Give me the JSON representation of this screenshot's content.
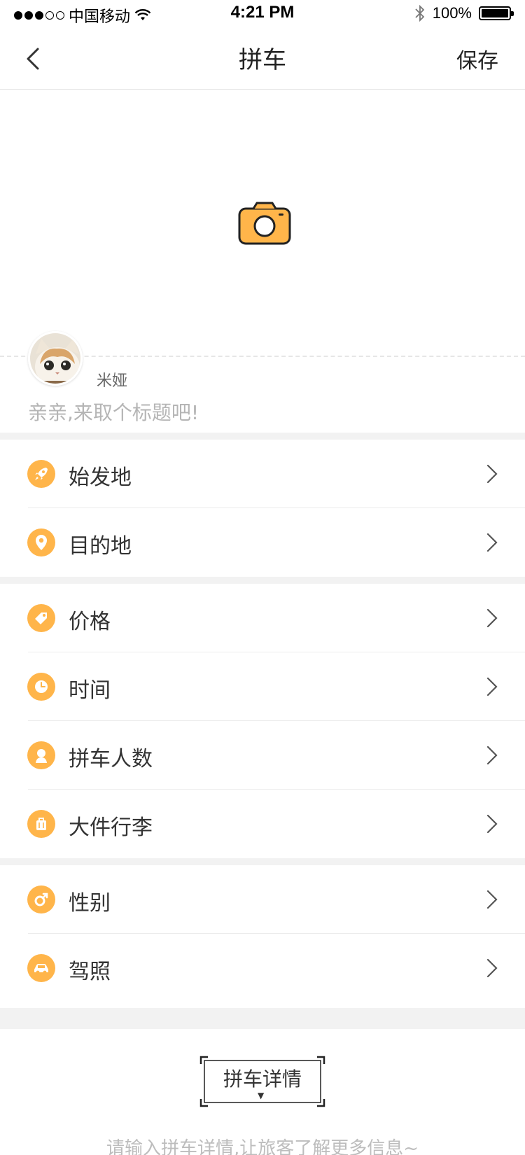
{
  "status_bar": {
    "carrier": "中国移动",
    "time": "4:21 PM",
    "battery": "100%"
  },
  "nav": {
    "title": "拼车",
    "save_label": "保存"
  },
  "post": {
    "username": "米娅",
    "title_placeholder": "亲亲,来取个标题吧!"
  },
  "groups": [
    {
      "items": [
        {
          "label": "始发地",
          "icon": "rocket-icon"
        },
        {
          "label": "目的地",
          "icon": "location-pin-icon"
        }
      ]
    },
    {
      "items": [
        {
          "label": "价格",
          "icon": "price-tag-icon"
        },
        {
          "label": "时间",
          "icon": "clock-icon"
        },
        {
          "label": "拼车人数",
          "icon": "person-icon"
        },
        {
          "label": "大件行李",
          "icon": "luggage-icon"
        }
      ]
    },
    {
      "items": [
        {
          "label": "性别",
          "icon": "gender-icon"
        },
        {
          "label": "驾照",
          "icon": "car-icon"
        }
      ]
    }
  ],
  "details": {
    "tag_label": "拼车详情",
    "placeholder": "请输入拼车详情,让旅客了解更多信息~"
  },
  "colors": {
    "accent": "#ffb54a",
    "divider": "#ececec",
    "placeholder": "#b5b5b5"
  }
}
